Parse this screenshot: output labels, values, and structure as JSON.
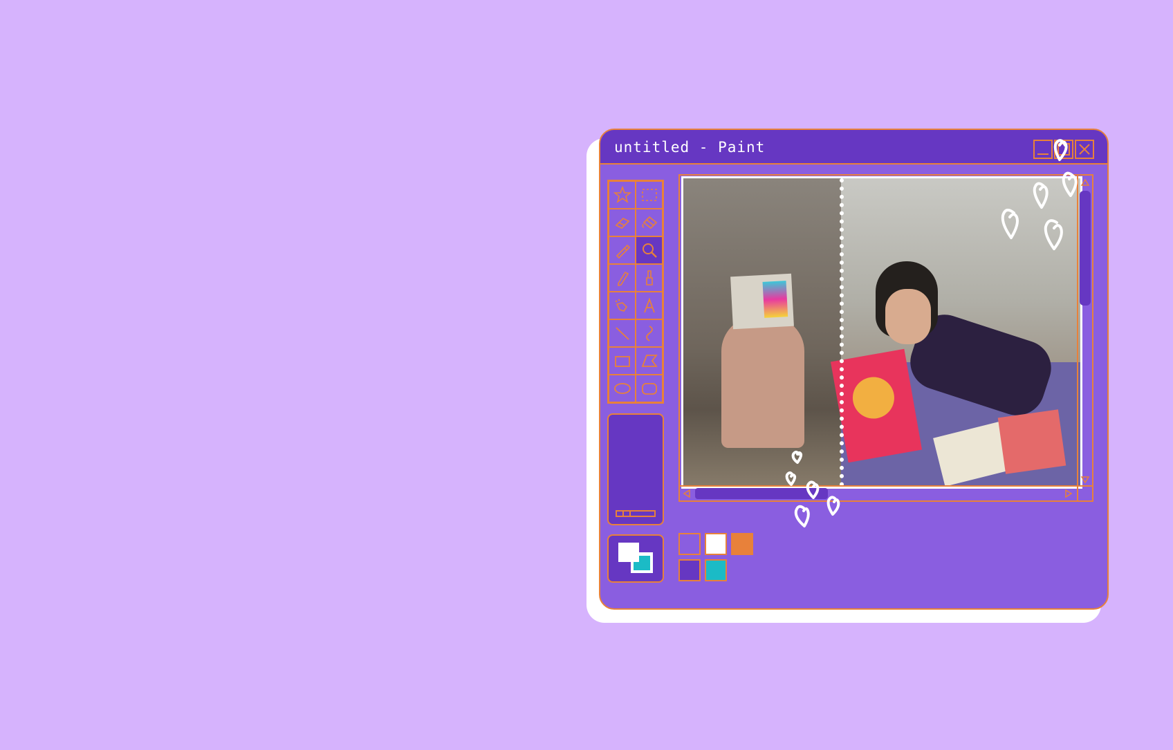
{
  "window": {
    "title": "untitled - Paint",
    "controls": [
      "minimize-icon",
      "maximize-icon",
      "close-icon"
    ]
  },
  "toolbox": {
    "tools": [
      {
        "name": "free-form-select",
        "icon": "star-select-icon"
      },
      {
        "name": "rectangle-select",
        "icon": "rect-select-icon"
      },
      {
        "name": "eraser",
        "icon": "eraser-icon"
      },
      {
        "name": "fill",
        "icon": "paint-bucket-icon"
      },
      {
        "name": "pick-color",
        "icon": "eyedropper-icon"
      },
      {
        "name": "magnifier",
        "icon": "magnifier-icon",
        "active": true
      },
      {
        "name": "pencil",
        "icon": "pencil-icon"
      },
      {
        "name": "brush",
        "icon": "brush-icon"
      },
      {
        "name": "airbrush",
        "icon": "airbrush-icon"
      },
      {
        "name": "text",
        "icon": "text-icon",
        "glyph": "A"
      },
      {
        "name": "line",
        "icon": "line-icon"
      },
      {
        "name": "curve",
        "icon": "curve-icon"
      },
      {
        "name": "rectangle",
        "icon": "rectangle-icon"
      },
      {
        "name": "polygon",
        "icon": "polygon-icon"
      },
      {
        "name": "ellipse",
        "icon": "ellipse-icon"
      },
      {
        "name": "rounded-rectangle",
        "icon": "rounded-rect-icon"
      }
    ]
  },
  "colors": {
    "foreground": "#ffffff",
    "background": "#1bbbc6",
    "palette": [
      "#8a5ee0",
      "#ffffff",
      "#e8813a",
      "#6637c2",
      "#1bbbc6"
    ]
  },
  "theme": {
    "page_bg": "#d6b3fd",
    "window_bg": "#8a5ee0",
    "titlebar_bg": "#6637c2",
    "accent": "#e8813a"
  },
  "canvas": {
    "image": "photo-two-women-reading-books"
  }
}
